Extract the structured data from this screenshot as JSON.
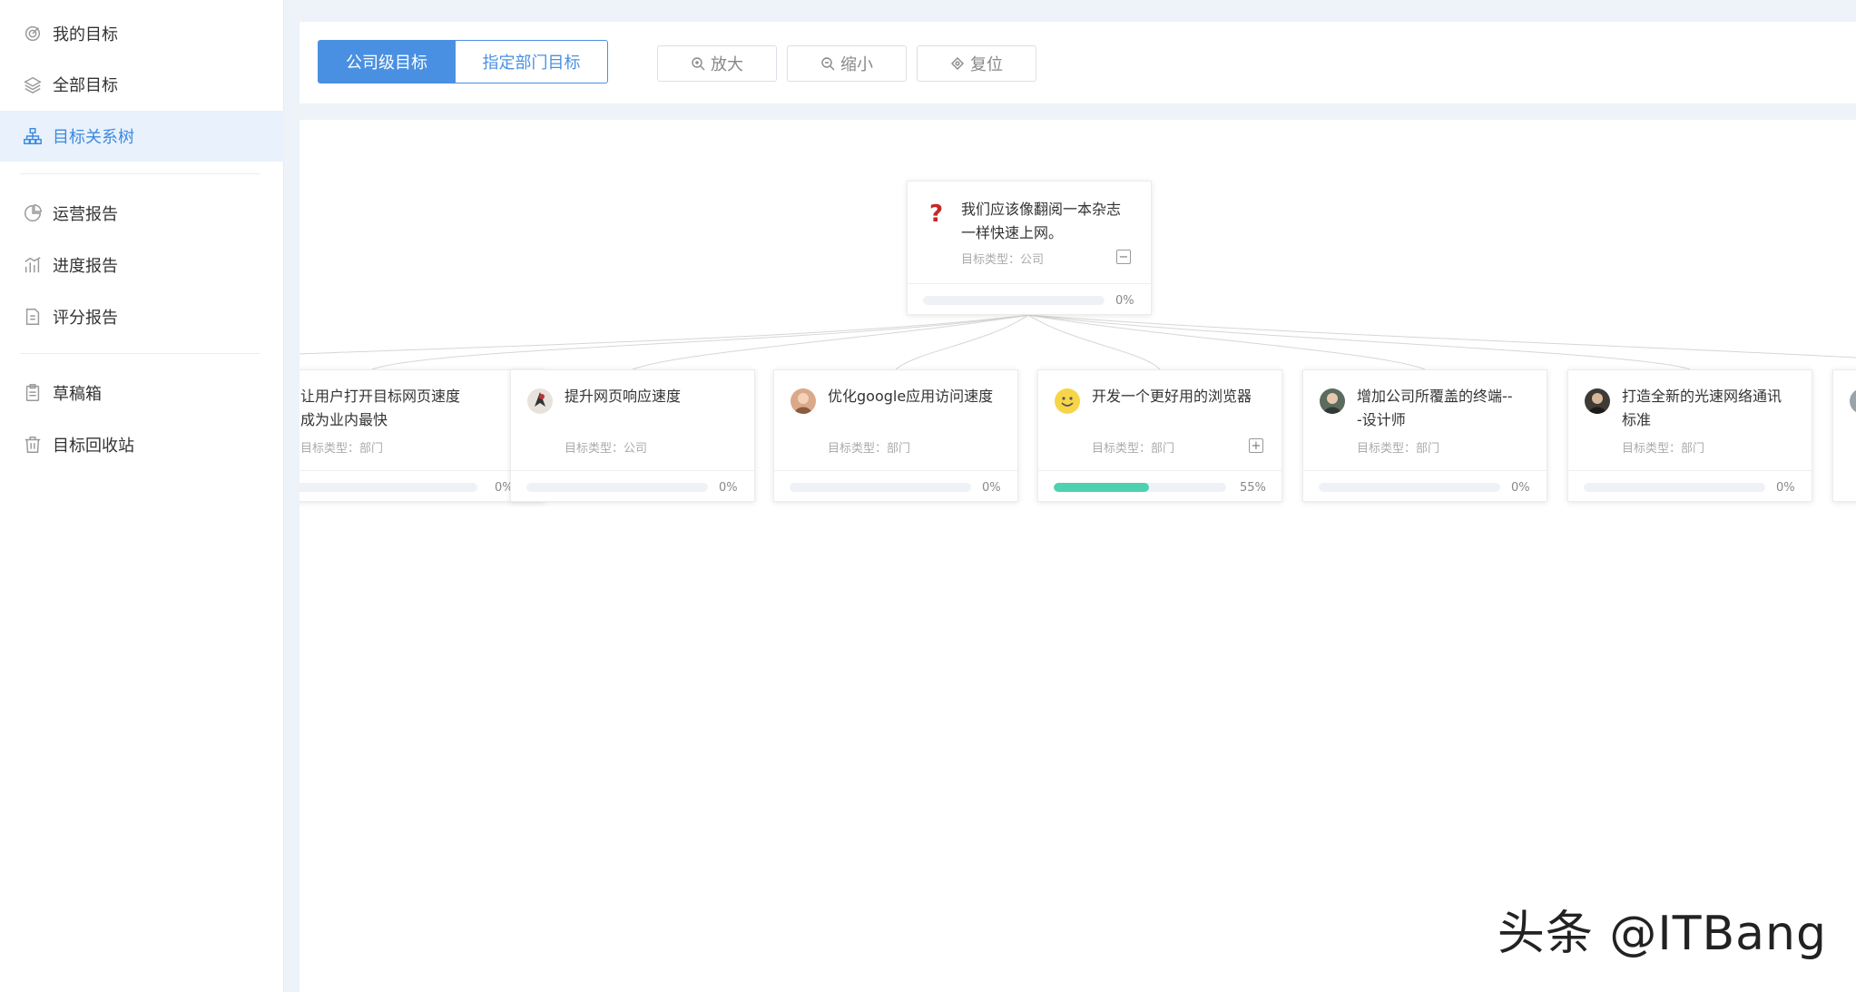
{
  "sidebar": {
    "items": [
      {
        "label": "我的目标",
        "icon": "target-icon"
      },
      {
        "label": "全部目标",
        "icon": "layers-icon"
      },
      {
        "label": "目标关系树",
        "icon": "org-tree-icon",
        "active": true
      },
      {
        "label": "运营报告",
        "icon": "pie-chart-icon"
      },
      {
        "label": "进度报告",
        "icon": "bar-chart-icon"
      },
      {
        "label": "评分报告",
        "icon": "document-icon"
      },
      {
        "label": "草稿箱",
        "icon": "clipboard-icon"
      },
      {
        "label": "目标回收站",
        "icon": "trash-icon"
      }
    ]
  },
  "toolbar": {
    "tab_company": "公司级目标",
    "tab_department": "指定部门目标",
    "zoom_in": "放大",
    "zoom_out": "缩小",
    "reset": "复位"
  },
  "tree": {
    "root": {
      "title_line1": "我们应该像翻阅一本杂志",
      "title_line2": "一样快速上网。",
      "type": "目标类型：公司",
      "progress": 0,
      "progress_label": "0%",
      "toggle": "−"
    },
    "children": [
      {
        "title_line1": "让用户打开目标网页速度",
        "title_line2": "成为业内最快",
        "type": "目标类型：部门",
        "progress": 0,
        "progress_label": "0%"
      },
      {
        "title_line1": "提升网页响应速度",
        "title_line2": "",
        "type": "目标类型：公司",
        "progress": 0,
        "progress_label": "0%"
      },
      {
        "title_line1": "优化google应用访问速度",
        "title_line2": "",
        "type": "目标类型：部门",
        "progress": 0,
        "progress_label": "0%"
      },
      {
        "title_line1": "开发一个更好用的浏览器",
        "title_line2": "",
        "type": "目标类型：部门",
        "progress": 55,
        "progress_label": "55%",
        "toggle": "+"
      },
      {
        "title_line1": "增加公司所覆盖的终端--",
        "title_line2": "-设计师",
        "type": "目标类型：部门",
        "progress": 0,
        "progress_label": "0%"
      },
      {
        "title_line1": "打造全新的光速网络通讯",
        "title_line2": "标准",
        "type": "目标类型：部门",
        "progress": 0,
        "progress_label": "0%"
      }
    ]
  },
  "colors": {
    "accent": "#4a90e2",
    "progress_fill": "#4fd1b0",
    "active_bg": "#e8f1fc"
  },
  "watermark": "头条 @ITBang"
}
